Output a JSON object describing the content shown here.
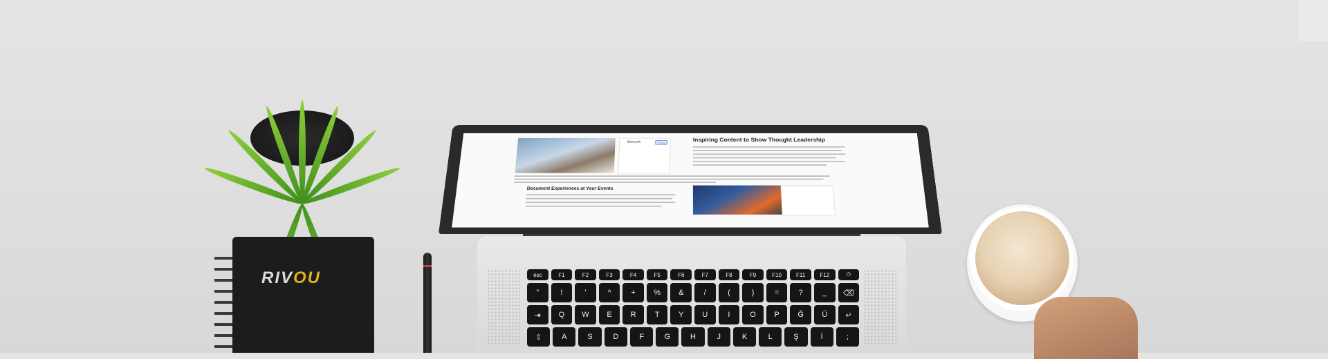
{
  "notebook": {
    "brand_prefix": "RIV",
    "brand_suffix": "OU"
  },
  "screen": {
    "heading1": "Inspiring Content to Show Thought Leadership",
    "heading2": "Document Experiences at Your Events",
    "card_brand": "Microsoft",
    "card_follow": "Follow"
  },
  "keyboard": {
    "fn_row": [
      "esc",
      "F1",
      "F2",
      "F3",
      "F4",
      "F5",
      "F6",
      "F7",
      "F8",
      "F9",
      "F10",
      "F11",
      "F12",
      "⏻"
    ],
    "row1": [
      "\"",
      "!",
      "'",
      "^",
      "+",
      "%",
      "&",
      "/",
      "(",
      ")",
      "=",
      "?",
      "_",
      "⌫"
    ],
    "row2": [
      "⇥",
      "Q",
      "W",
      "E",
      "R",
      "T",
      "Y",
      "U",
      "I",
      "O",
      "P",
      "Ğ",
      "Ü",
      "↵"
    ],
    "row3": [
      "⇪",
      "A",
      "S",
      "D",
      "F",
      "G",
      "H",
      "J",
      "K",
      "L",
      "Ş",
      "İ",
      ";"
    ]
  }
}
